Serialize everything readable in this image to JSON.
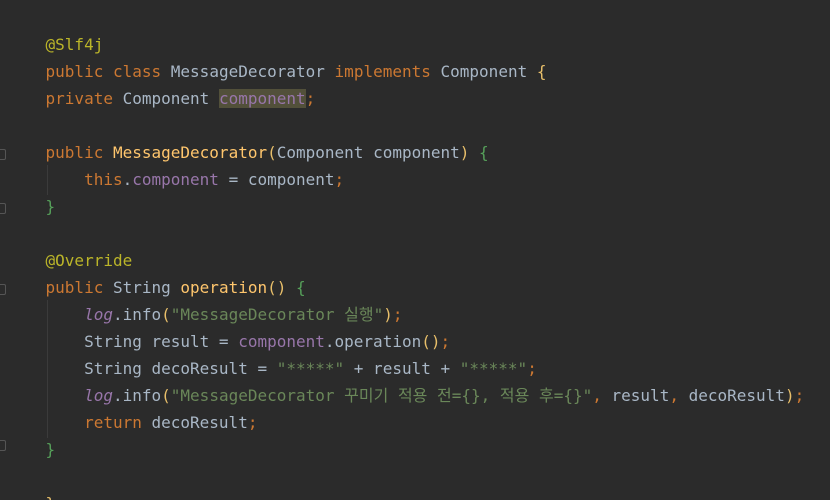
{
  "colors": {
    "background": "#2b2b2b",
    "keyword": "#cc7832",
    "annotation": "#bbb529",
    "field": "#9876aa",
    "method_declaration": "#ffc66d",
    "string": "#6a8759",
    "default_text": "#a9b7c6"
  },
  "code": {
    "l1_annotation": "@Slf4j",
    "l2_public": "public",
    "l2_class": "class",
    "l2_name": "MessageDecorator",
    "l2_implements": "implements",
    "l2_iface": "Component",
    "l2_brace": "{",
    "l4_private": "private",
    "l4_type": "Component",
    "l4_field": "component",
    "l4_semi": ";",
    "l6_public": "public",
    "l6_ctor": "MessageDecorator",
    "l6_open": "(",
    "l6_params": "Component component",
    "l6_close": ")",
    "l6_brace": "{",
    "l7_this": "this",
    "l7_dot": ".",
    "l7_field": "component",
    "l7_assign": " = component",
    "l7_semi": ";",
    "l8_brace": "}",
    "l10_override": "@Override",
    "l11_public": "public",
    "l11_type": "String",
    "l11_method": "operation",
    "l11_parens": "()",
    "l11_brace": "{",
    "l12_log": "log",
    "l12_info": ".info",
    "l12_open": "(",
    "l12_str": "\"MessageDecorator 실행\"",
    "l12_close": ")",
    "l12_semi": ";",
    "l13_decl": "String result = ",
    "l13_field": "component",
    "l13_call": ".operation",
    "l13_parens": "()",
    "l13_semi": ";",
    "l14_decl": "String decoResult = ",
    "l14_str1": "\"*****\"",
    "l14_plus": " + result + ",
    "l14_str2": "\"*****\"",
    "l14_semi": ";",
    "l15_log": "log",
    "l15_info": ".info",
    "l15_open": "(",
    "l15_str": "\"MessageDecorator 꾸미기 적용 전={}, 적용 후={}\"",
    "l15_comma1": ",",
    "l15_arg1": " result",
    "l15_comma2": ",",
    "l15_arg2": " decoResult",
    "l15_close": ")",
    "l15_semi": ";",
    "l16_return": "return",
    "l16_value": " decoResult",
    "l16_semi": ";",
    "l17_brace": "}",
    "l18_brace": "}"
  }
}
